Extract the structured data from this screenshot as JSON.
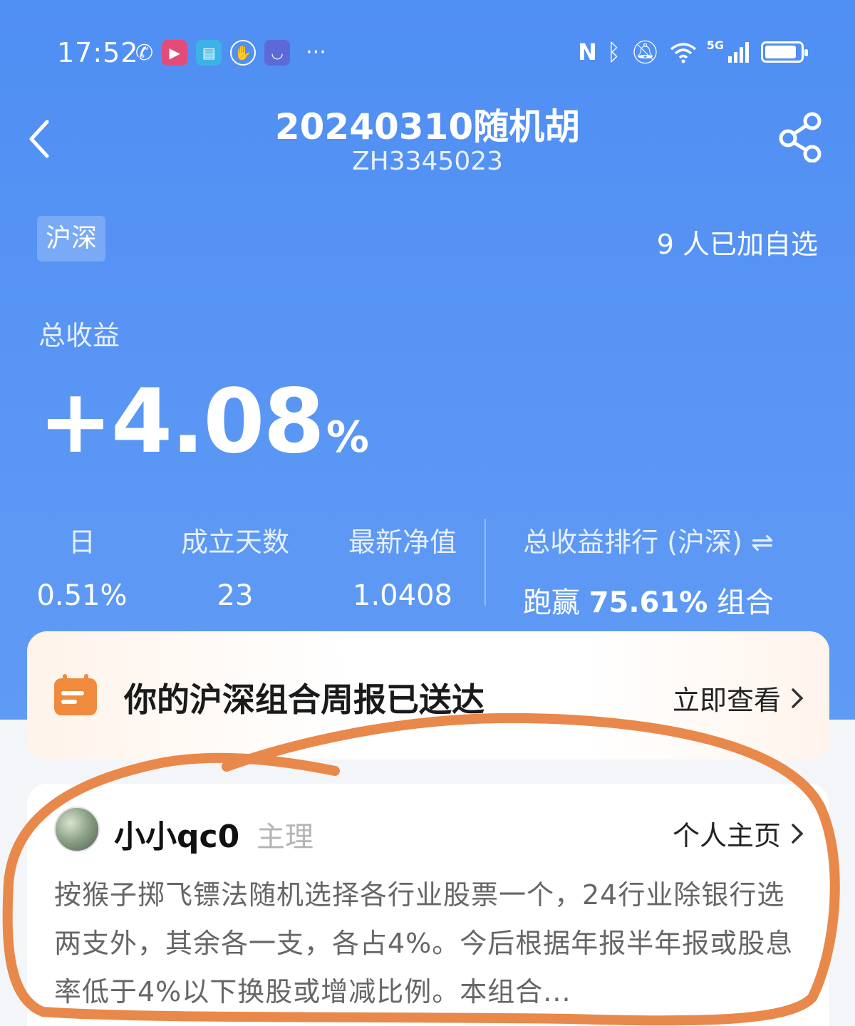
{
  "status_bar": {
    "time": "17:52",
    "dots": "···",
    "network": "5G",
    "battery_level": 0.9
  },
  "header": {
    "title": "20240310随机胡",
    "code": "ZH3345023"
  },
  "portfolio": {
    "market_tag": "沪深",
    "watchers": "9 人已加自选",
    "total_label": "总收益",
    "total_value": "+4.08",
    "total_unit": "%"
  },
  "stats": [
    {
      "label": "日",
      "value": "0.51%"
    },
    {
      "label": "成立天数",
      "value": "23"
    },
    {
      "label": "最新净值",
      "value": "1.0408"
    }
  ],
  "ranking": {
    "label": "总收益排行 (沪深)",
    "switch_icon": "⇌",
    "prefix": "跑赢",
    "percent": "75.61%",
    "suffix": "组合"
  },
  "report": {
    "text": "你的沪深组合周报已送达",
    "link": "立即查看"
  },
  "author": {
    "name": "小小qc0",
    "role": "主理",
    "profile_link": "个人主页",
    "description": "按猴子掷飞镖法随机选择各行业股票一个，24行业除银行选两支外，其余各一支，各占4%。今后根据年报半年报或股息率低于4%以下换股或增减比例。本组合..."
  },
  "colors": {
    "hero_blue": "#5a96f4",
    "annotation_orange": "#e8884a",
    "report_icon_orange": "#f08a3c"
  }
}
